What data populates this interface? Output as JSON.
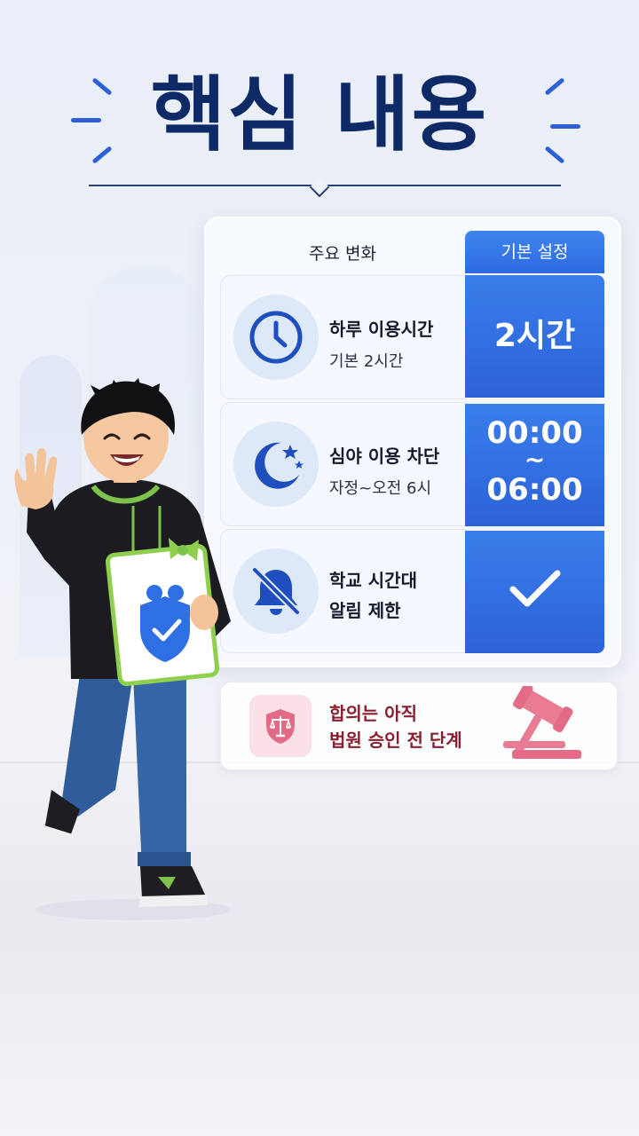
{
  "title": "핵심 내용",
  "table": {
    "left_header": "주요 변화",
    "right_header": "기본 설정",
    "rows": [
      {
        "icon": "clock-icon",
        "title": "하루 이용시간",
        "subtitle": "기본 2시간",
        "value": "2시간"
      },
      {
        "icon": "moon-stars-icon",
        "title": "심야 이용 차단",
        "subtitle": "자정~오전 6시",
        "value_lines": [
          "00:00",
          "~",
          "06:00"
        ]
      },
      {
        "icon": "bell-off-icon",
        "title_lines": [
          "학교 시간대",
          "알림 제한"
        ],
        "value_icon": "checkmark-icon"
      }
    ]
  },
  "notice": {
    "icon": "justice-shield-icon",
    "lines": [
      "합의는 아직",
      "법원 승인 전 단계"
    ],
    "decoration": "gavel-icon"
  },
  "colors": {
    "title": "#0d2a66",
    "accent_blue": "#2f6fe4",
    "notice_text": "#8a1e2e",
    "notice_accent": "#e87c93"
  },
  "illustration": "smiling-boy-waving-holding-parental-control-sign"
}
